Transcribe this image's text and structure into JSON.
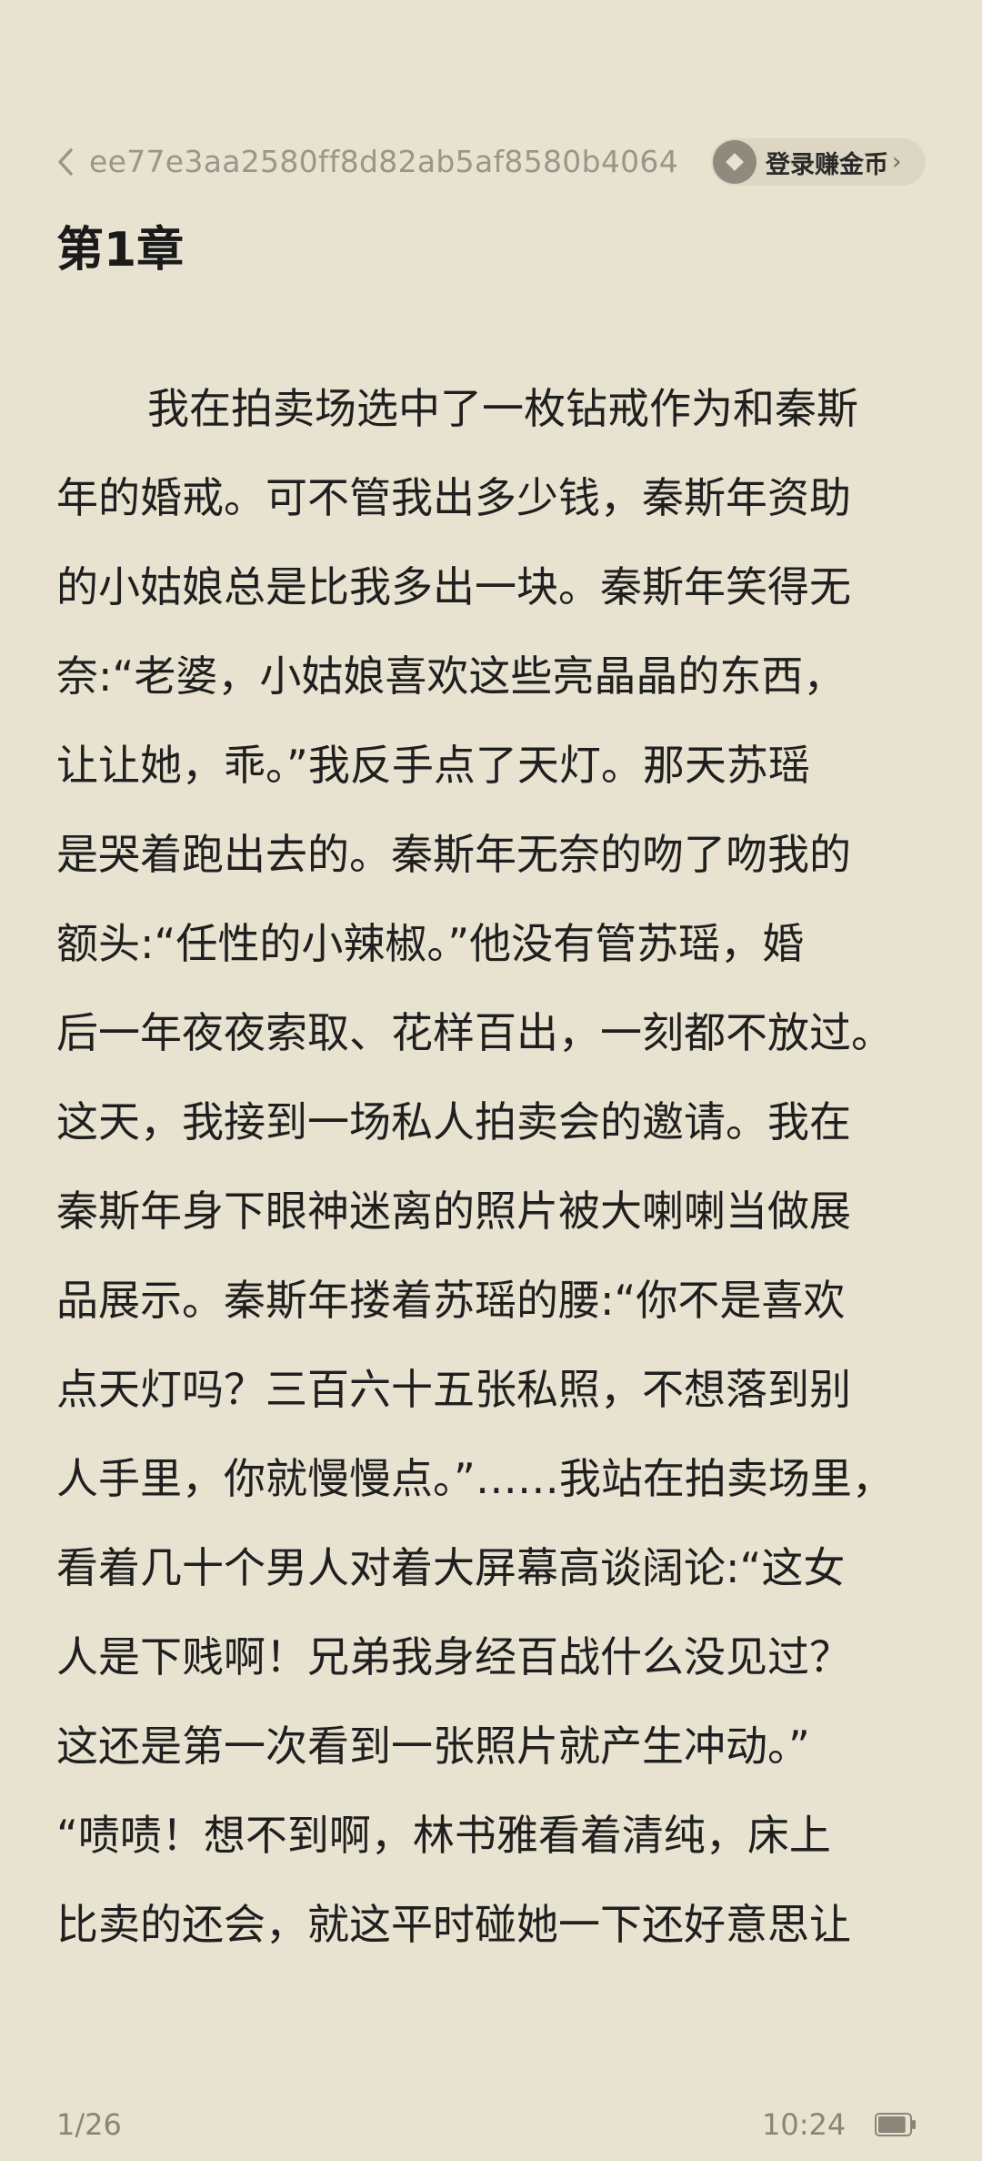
{
  "header": {
    "book_id": "ee77e3aa2580ff8d82ab5af8580b4064",
    "coins_label": "登录赚金币",
    "coins_chevron": "›"
  },
  "chapter": {
    "title": "第1章"
  },
  "content": {
    "lines": [
      "我在拍卖场选中了一枚钻戒作为和秦斯",
      "年的婚戒。可不管我出多少钱，秦斯年资助",
      "的小姑娘总是比我多出一块。秦斯年笑得无",
      "奈:“老婆，小姑娘喜欢这些亮晶晶的东西，",
      "让让她，乖。”我反手点了天灯。那天苏瑶",
      "是哭着跑出去的。秦斯年无奈的吻了吻我的",
      "额头:“任性的小辣椒。”他没有管苏瑶，婚",
      "后一年夜夜索取、花样百出，一刻都不放过。",
      "这天，我接到一场私人拍卖会的邀请。我在",
      "秦斯年身下眼神迷离的照片被大喇喇当做展",
      "品展示。秦斯年搂着苏瑶的腰:“你不是喜欢",
      "点天灯吗？三百六十五张私照，不想落到别",
      "人手里，你就慢慢点。”……我站在拍卖场里，",
      "看着几十个男人对着大屏幕高谈阔论:“这女",
      "人是下贱啊！兄弟我身经百战什么没见过？",
      "这还是第一次看到一张照片就产生冲动。”",
      "“啧啧！想不到啊，林书雅看着清纯，床上",
      "比卖的还会，就这平时碰她一下还好意思让"
    ]
  },
  "footer": {
    "page": "1/26",
    "time": "10:24",
    "battery_level": 0.9
  }
}
